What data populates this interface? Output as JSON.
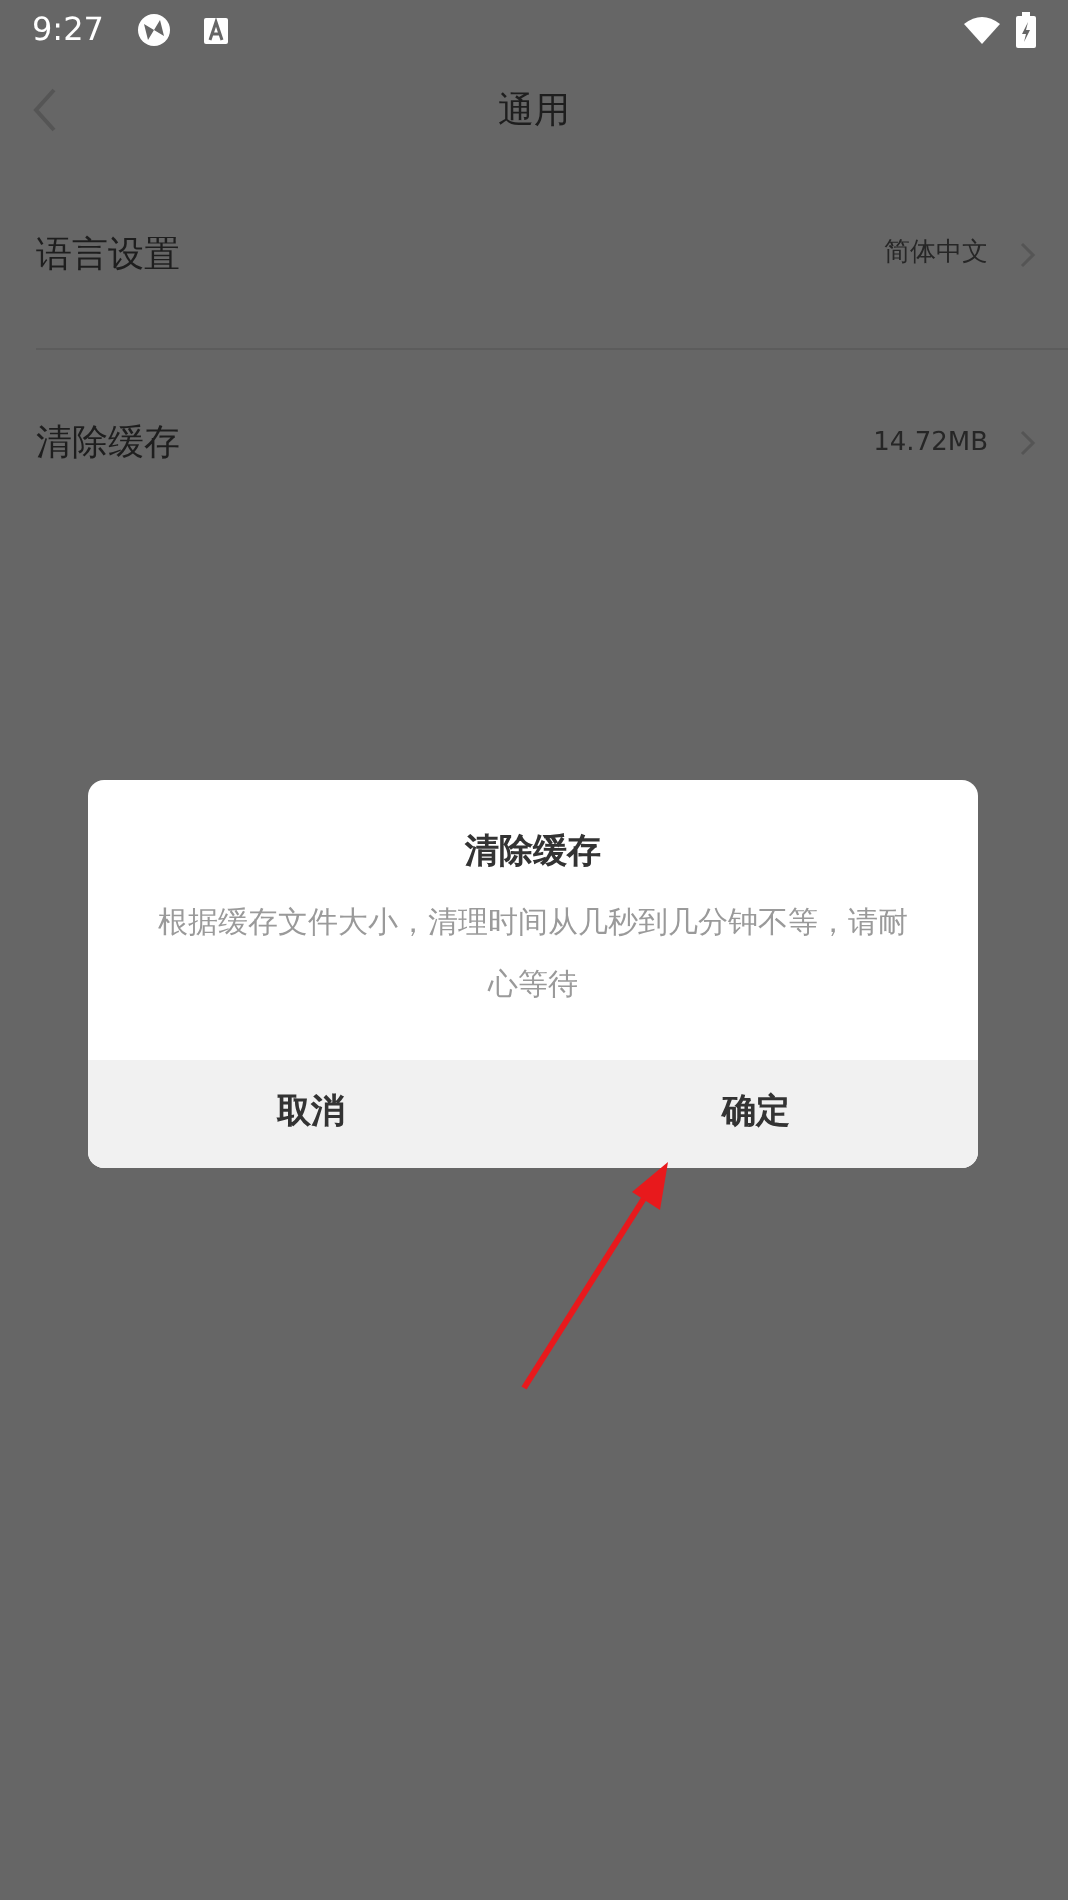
{
  "status_bar": {
    "time": "9:27"
  },
  "header": {
    "title": "通用"
  },
  "settings": [
    {
      "label": "语言设置",
      "value": "简体中文"
    },
    {
      "label": "清除缓存",
      "value": "14.72MB"
    }
  ],
  "dialog": {
    "title": "清除缓存",
    "message": "根据缓存文件大小，清理时间从几秒到几分钟不等，请耐心等待",
    "buttons": [
      "取消",
      "确定"
    ]
  }
}
